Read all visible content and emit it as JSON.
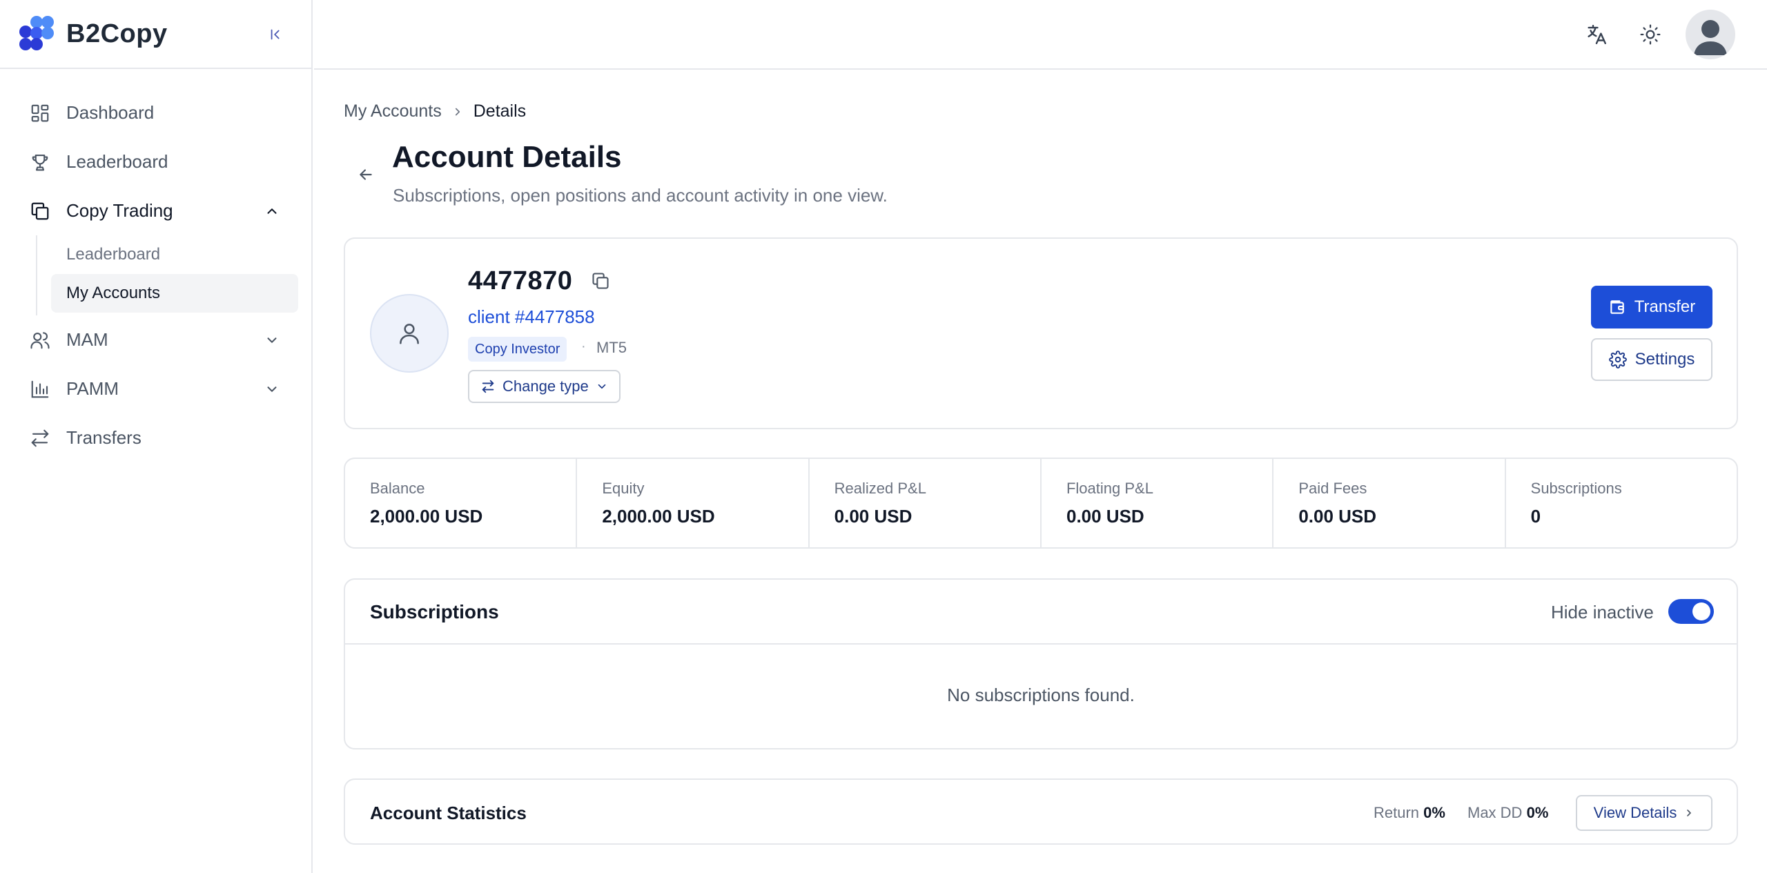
{
  "brand": {
    "name": "B2Copy",
    "colors": {
      "accent": "#1d4ed8",
      "logo_dark": "#2b3bd6",
      "logo_light": "#4f8cf7"
    }
  },
  "sidebar": {
    "items": [
      {
        "label": "Dashboard",
        "icon": "dashboard-icon"
      },
      {
        "label": "Leaderboard",
        "icon": "trophy-icon"
      },
      {
        "label": "Copy Trading",
        "icon": "copy-icon",
        "expanded": true,
        "children": [
          {
            "label": "Leaderboard"
          },
          {
            "label": "My Accounts",
            "active": true
          }
        ]
      },
      {
        "label": "MAM",
        "icon": "users-icon"
      },
      {
        "label": "PAMM",
        "icon": "bar-chart-icon"
      },
      {
        "label": "Transfers",
        "icon": "arrows-swap-icon"
      }
    ]
  },
  "breadcrumb": {
    "parent": "My Accounts",
    "current": "Details"
  },
  "page": {
    "title": "Account Details",
    "subtitle": "Subscriptions, open positions and account activity in one view."
  },
  "account": {
    "number": "4477870",
    "client": "client #4477858",
    "type": "Copy Investor",
    "separator": "·",
    "platform": "MT5",
    "change_type_label": "Change type",
    "transfer_label": "Transfer",
    "settings_label": "Settings"
  },
  "stats": [
    {
      "label": "Balance",
      "value": "2,000.00 USD"
    },
    {
      "label": "Equity",
      "value": "2,000.00 USD"
    },
    {
      "label": "Realized P&L",
      "value": "0.00 USD"
    },
    {
      "label": "Floating P&L",
      "value": "0.00 USD"
    },
    {
      "label": "Paid Fees",
      "value": "0.00 USD"
    },
    {
      "label": "Subscriptions",
      "value": "0"
    }
  ],
  "subscriptions": {
    "title": "Subscriptions",
    "hide_inactive_label": "Hide inactive",
    "hide_inactive": true,
    "empty_text": "No subscriptions found."
  },
  "account_statistics": {
    "title": "Account Statistics",
    "return_label": "Return",
    "return_value": "0%",
    "maxdd_label": "Max DD",
    "maxdd_value": "0%",
    "view_details_label": "View Details"
  }
}
